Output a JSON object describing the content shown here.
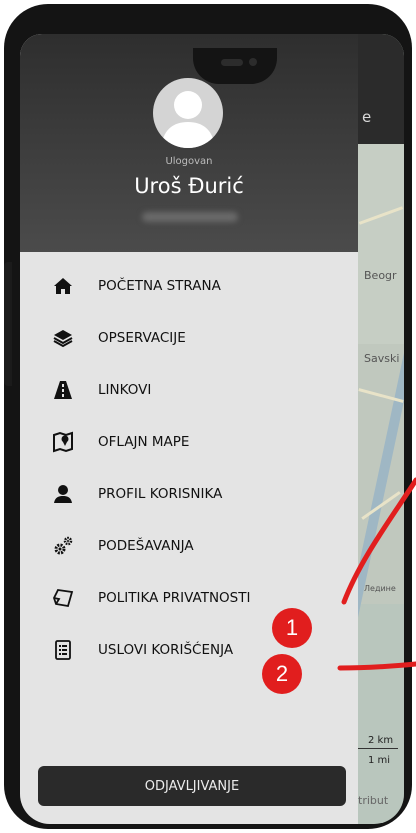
{
  "header": {
    "logged_label": "Ulogovan",
    "user_name": "Uroš Đurić"
  },
  "map": {
    "appbar_text": "e",
    "labels": [
      "Beogr",
      "Savski",
      "Ледине"
    ],
    "scale_km": "2 km",
    "scale_mi": "1 mi",
    "attribution": "tribut"
  },
  "menu": {
    "items": [
      {
        "label": "POČETNA STRANA",
        "icon": "home-icon"
      },
      {
        "label": "OPSERVACIJE",
        "icon": "layers-icon"
      },
      {
        "label": "LINKOVI",
        "icon": "road-icon"
      },
      {
        "label": "OFLAJN MAPE",
        "icon": "map-pin-icon"
      },
      {
        "label": "PROFIL KORISNIKA",
        "icon": "user-icon"
      },
      {
        "label": "PODEŠAVANJA",
        "icon": "gears-icon"
      },
      {
        "label": "POLITIKA PRIVATNOSTI",
        "icon": "sticky-note-icon"
      },
      {
        "label": "USLOVI KORIŠĆENJA",
        "icon": "list-doc-icon"
      }
    ]
  },
  "logout_label": "ODJAVLJIVANJE",
  "annotations": [
    {
      "label": "1",
      "color": "#e11e1e"
    },
    {
      "label": "2",
      "color": "#e11e1e"
    }
  ],
  "colors": {
    "drawer_bg": "#e4e4e4",
    "header_bg": "#3a3a3a",
    "accent_red": "#e11e1e"
  }
}
